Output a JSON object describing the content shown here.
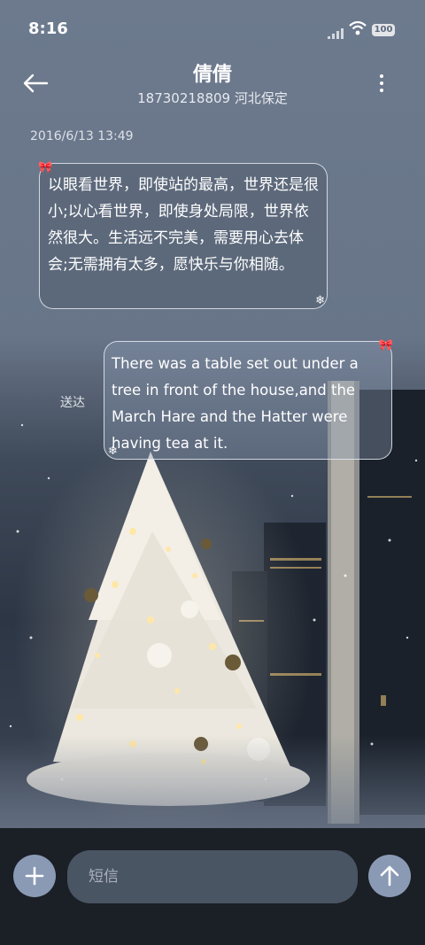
{
  "status_bar": {
    "time": "8:16",
    "battery": "100",
    "icons": [
      "signal-icon",
      "wifi-icon",
      "battery-icon"
    ]
  },
  "header": {
    "contact_name": "倩倩",
    "contact_info": "18730218809 河北保定",
    "back_icon": "arrow-left-icon",
    "more_icon": "more-vertical-icon"
  },
  "conversation": {
    "timestamp": "2016/6/13 13:49",
    "messages": [
      {
        "direction": "incoming",
        "text": "以眼看世界，即使站的最高，世界还是很小;以心看世界，即使身处局限，世界依然很大。生活远不完美，需要用心去体会;无需拥有太多，愿快乐与你相随。"
      },
      {
        "direction": "outgoing",
        "text": "There was a table set out under a tree in front of the house,and the March Hare and the Hatter were having tea at it.",
        "status": "送达"
      }
    ]
  },
  "composer": {
    "placeholder": "短信",
    "add_icon": "plus-icon",
    "send_icon": "arrow-up-icon"
  },
  "colors": {
    "background_top": "#6d7a8e",
    "bottom_bar": "#1b1f26",
    "button": "#8a9ab4",
    "input": "#4a5564"
  }
}
